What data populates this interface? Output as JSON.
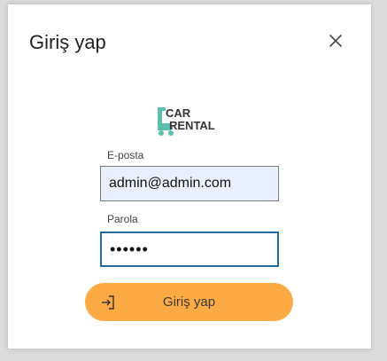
{
  "dialog": {
    "title": "Giriş yap",
    "close_icon": "close-icon"
  },
  "logo": {
    "line1": "CAR",
    "line2": "RENTAL",
    "accent_color": "#5bbfb1"
  },
  "form": {
    "email_label": "E-posta",
    "email_value": "admin@admin.com",
    "password_label": "Parola",
    "password_value": "••••••"
  },
  "submit": {
    "label": "Giriş yap",
    "icon": "sign-in-icon",
    "color": "#fcab44"
  }
}
